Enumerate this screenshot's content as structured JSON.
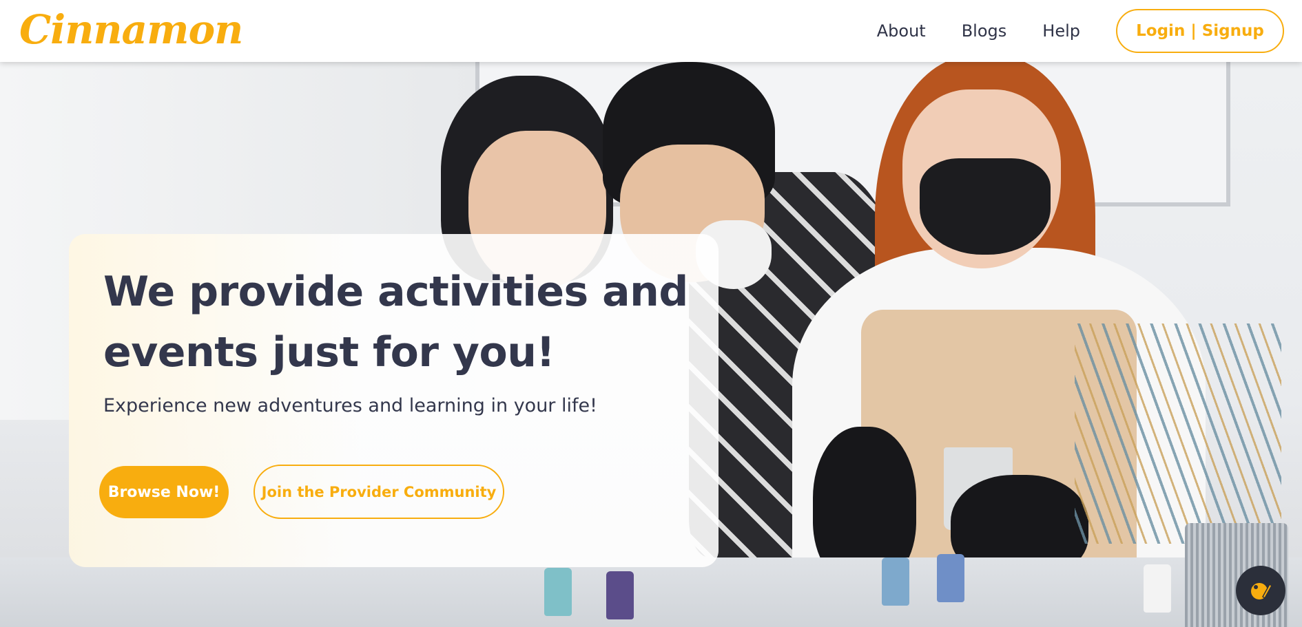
{
  "header": {
    "logo": "Cinnamon",
    "nav": [
      {
        "label": "About"
      },
      {
        "label": "Blogs"
      },
      {
        "label": "Help"
      }
    ],
    "login_label": "Login | Signup"
  },
  "hero": {
    "headline": "We provide activities and events just for you!",
    "subline": "Experience new adventures and learning in your life!",
    "browse_label": "Browse Now!",
    "join_label": "Join the Provider Community"
  },
  "fab": {
    "icon": "paint-palette-icon"
  },
  "colors": {
    "accent": "#f8ad0f",
    "text": "#33374c",
    "header_bg": "#ffffff"
  }
}
